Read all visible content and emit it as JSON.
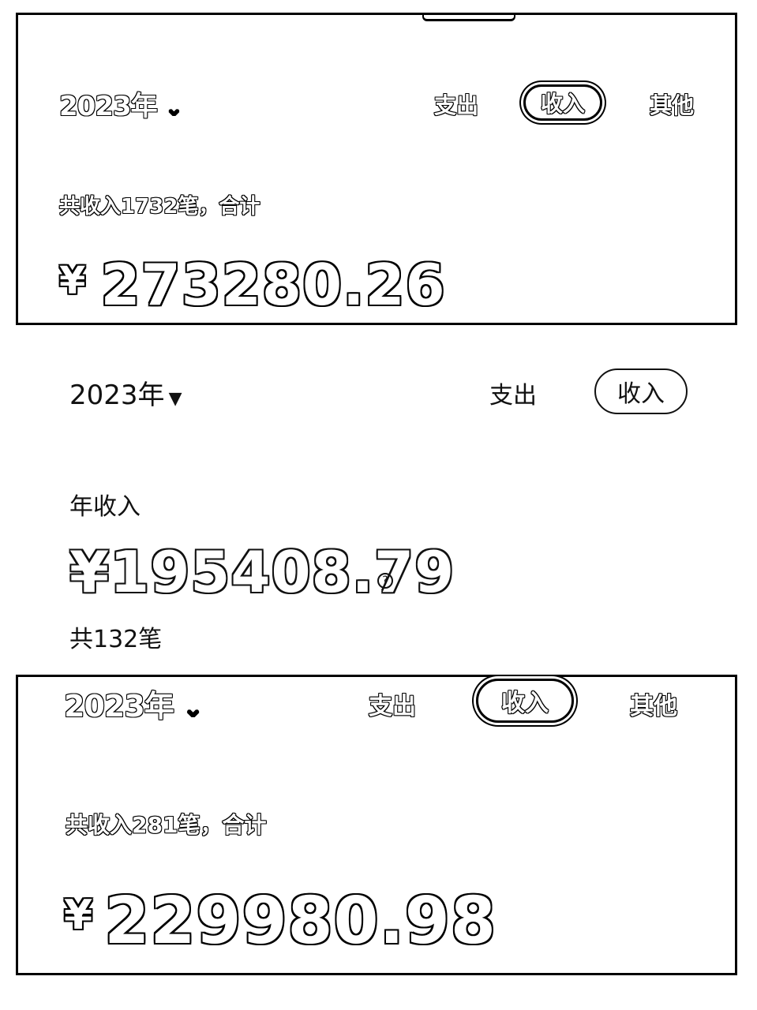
{
  "panel_top": {
    "year": "2023年",
    "tabs": {
      "expense": "支出",
      "income": "收入",
      "other": "其他"
    },
    "active_tab": "income",
    "summary": "共收入1732笔，合计",
    "currency": "¥",
    "amount": "273280.26"
  },
  "panel_middle": {
    "year": "2023年",
    "tabs": {
      "expense": "支出",
      "income": "收入"
    },
    "active_tab": "income",
    "label": "年收入",
    "currency": "¥",
    "amount": "195408.79",
    "help": "?",
    "count": "共132笔"
  },
  "panel_bottom": {
    "year": "2023年",
    "tabs": {
      "expense": "支出",
      "income": "收入",
      "other": "其他"
    },
    "active_tab": "income",
    "summary": "共收入281笔，合计",
    "currency": "¥",
    "amount": "229980.98"
  },
  "icons": {
    "dropdown_chevron": "chevron-down-icon",
    "dropdown_caret": "caret-down-icon",
    "help": "help-circle-icon"
  }
}
